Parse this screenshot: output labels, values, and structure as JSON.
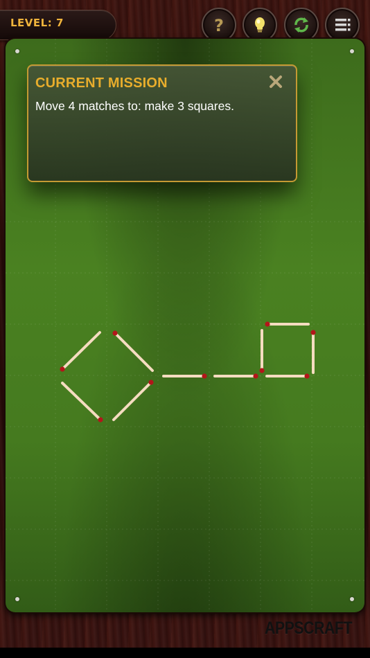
{
  "header": {
    "level_label": "LEVEL: 7",
    "buttons": [
      {
        "name": "help",
        "icon": "question-mark-icon"
      },
      {
        "name": "hint",
        "icon": "lightbulb-icon"
      },
      {
        "name": "restart",
        "icon": "refresh-icon"
      },
      {
        "name": "menu",
        "icon": "menu-list-icon"
      }
    ]
  },
  "mission": {
    "title": "CURRENT MISSION",
    "text": "Move 4 matches to: make 3 squares.",
    "close_icon": "close-icon"
  },
  "brand": {
    "name": "APPSCRAFT"
  },
  "colors": {
    "accent_gold": "#e8ad2c",
    "board_green": "#4a8121",
    "match_head": "#b3161a",
    "match_stick": "#f5dcc0"
  }
}
